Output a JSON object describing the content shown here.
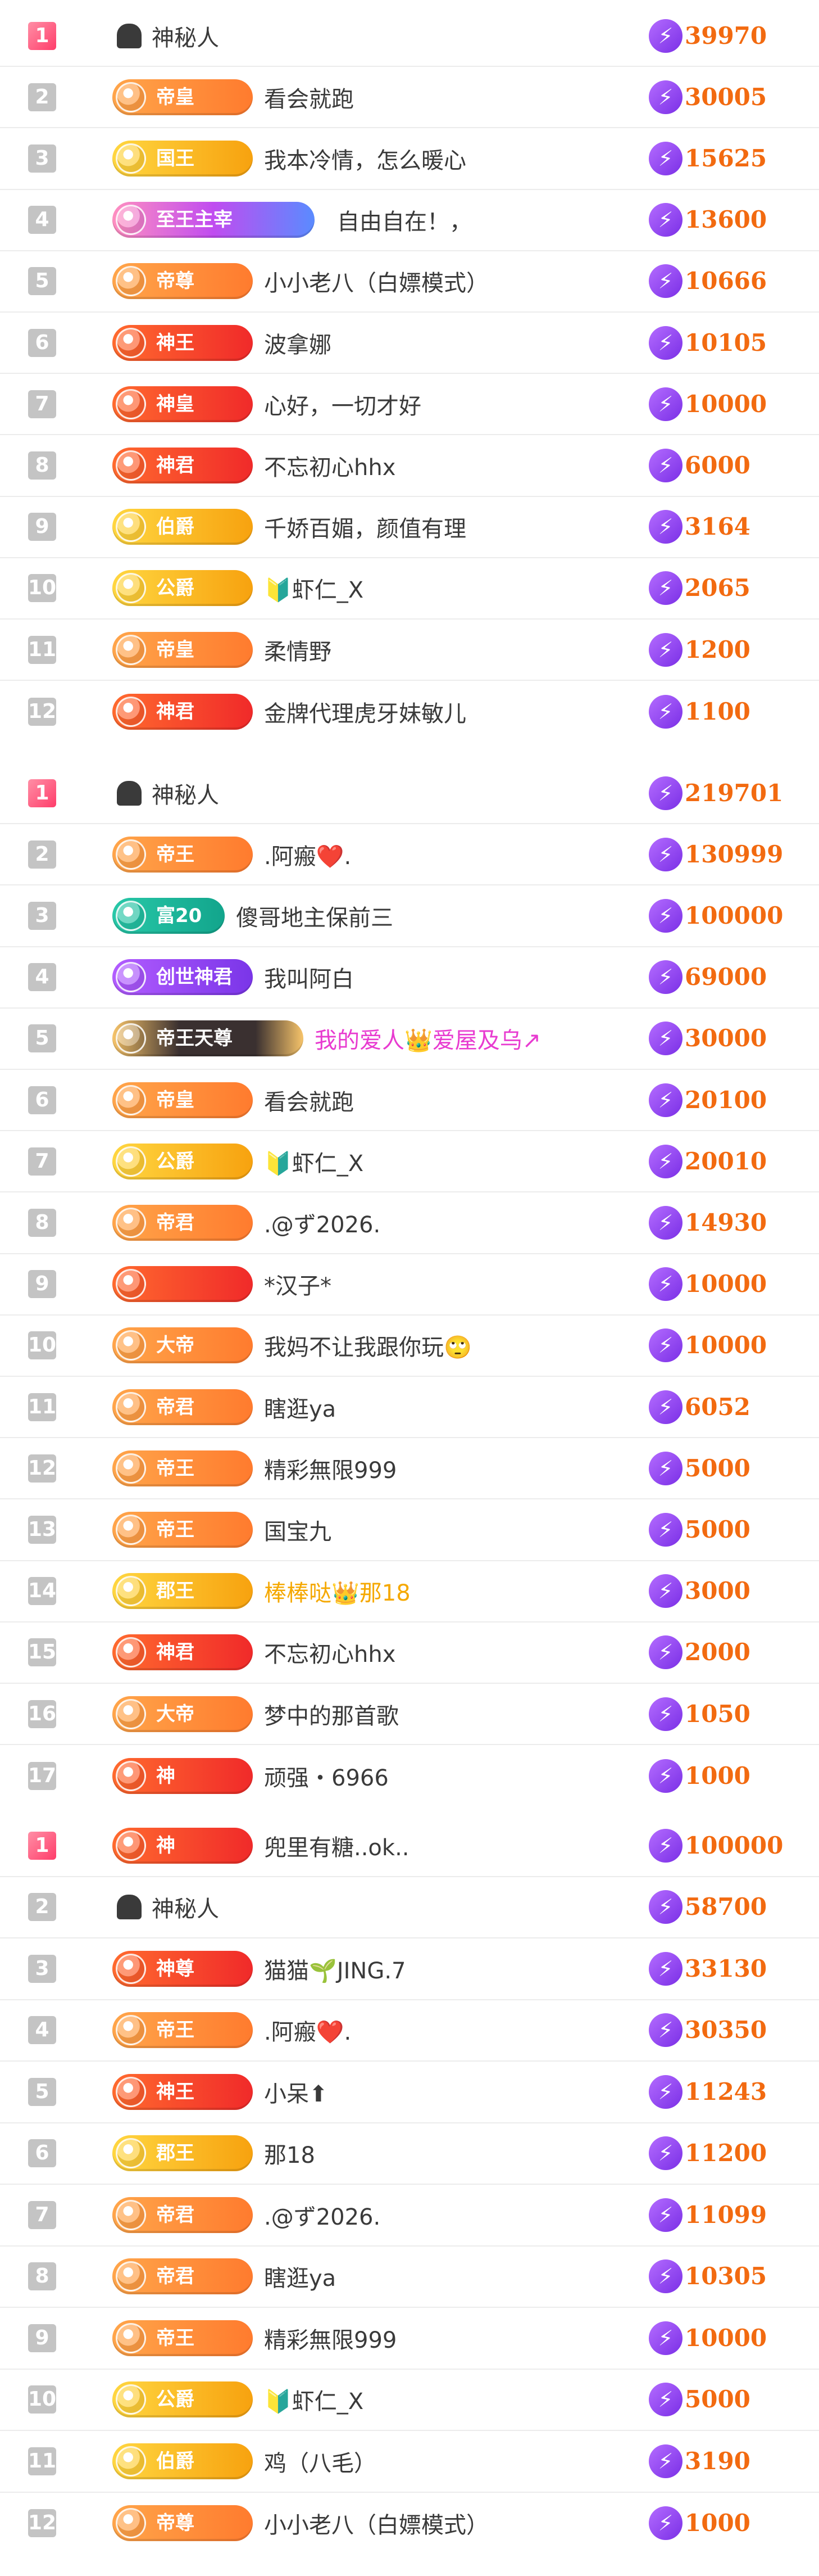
{
  "icons": {
    "bolt_icon": "lightning-bolt-icon",
    "badge_medal_icon": "medal-icon",
    "mystery_user_icon": "mystery-person-icon"
  },
  "colors": {
    "rank_first": "#ff3d6a",
    "rank_other": "#c4c4c4",
    "score_text": "#f26a10",
    "bolt_bg": "#7a2fe6"
  },
  "board1": {
    "rows": [
      {
        "rank": "1",
        "badge": "",
        "badge_style": "plain",
        "name": "神秘人",
        "score": "39970"
      },
      {
        "rank": "2",
        "badge": "帝皇",
        "badge_style": "orange",
        "name": "看会就跑",
        "score": "30005"
      },
      {
        "rank": "3",
        "badge": "国王",
        "badge_style": "gold",
        "name": "我本冷情，怎么暖心",
        "score": "15625"
      },
      {
        "rank": "4",
        "badge": "至王主宰",
        "badge_style": "pink",
        "name": "自由自在！，",
        "score": "13600"
      },
      {
        "rank": "5",
        "badge": "帝尊",
        "badge_style": "orange",
        "name": "小小老八（白嫖模式）",
        "score": "10666"
      },
      {
        "rank": "6",
        "badge": "神王",
        "badge_style": "red",
        "name": "波拿娜",
        "score": "10105"
      },
      {
        "rank": "7",
        "badge": "神皇",
        "badge_style": "red",
        "name": "心好，一切才好",
        "score": "10000"
      },
      {
        "rank": "8",
        "badge": "神君",
        "badge_style": "red",
        "name": "不忘初心hhx",
        "score": "6000"
      },
      {
        "rank": "9",
        "badge": "伯爵",
        "badge_style": "gold",
        "name": "千娇百媚，颜值有理",
        "score": "3164"
      },
      {
        "rank": "10",
        "badge": "公爵",
        "badge_style": "gold",
        "name": "🔰虾仁_X",
        "score": "2065"
      },
      {
        "rank": "11",
        "badge": "帝皇",
        "badge_style": "orange",
        "name": "柔情野",
        "score": "1200"
      },
      {
        "rank": "12",
        "badge": "神君",
        "badge_style": "red",
        "name": "金牌代理虎牙妹敏儿",
        "score": "1100"
      }
    ]
  },
  "board2": {
    "rows": [
      {
        "rank": "1",
        "badge": "",
        "badge_style": "plain",
        "name": "神秘人",
        "score": "219701"
      },
      {
        "rank": "2",
        "badge": "帝王",
        "badge_style": "orange",
        "name": ".阿瘢❤️.",
        "score": "130999"
      },
      {
        "rank": "3",
        "badge": "富20",
        "badge_style": "teal",
        "name": "傻哥地主保前三",
        "score": "100000"
      },
      {
        "rank": "4",
        "badge": "创世神君",
        "badge_style": "purple",
        "name": "我叫阿白",
        "score": "69000"
      },
      {
        "rank": "5",
        "badge": "帝王天尊",
        "badge_style": "dark",
        "name": "我的爱人👑爱屋及乌↗",
        "score": "30000"
      },
      {
        "rank": "6",
        "badge": "帝皇",
        "badge_style": "orange",
        "name": "看会就跑",
        "score": "20100"
      },
      {
        "rank": "7",
        "badge": "公爵",
        "badge_style": "gold",
        "name": "🔰虾仁_X",
        "score": "20010"
      },
      {
        "rank": "8",
        "badge": "帝君",
        "badge_style": "orange",
        "name": ".@ず2026.",
        "score": "14930"
      },
      {
        "rank": "9",
        "badge": "",
        "badge_style": "red",
        "name": "*汉子*",
        "score": "10000"
      },
      {
        "rank": "10",
        "badge": "大帝",
        "badge_style": "orange",
        "name": "我妈不让我跟你玩🙄",
        "score": "10000"
      },
      {
        "rank": "11",
        "badge": "帝君",
        "badge_style": "orange",
        "name": "瞎逛ya",
        "score": "6052"
      },
      {
        "rank": "12",
        "badge": "帝王",
        "badge_style": "orange",
        "name": "精彩無限999",
        "score": "5000"
      },
      {
        "rank": "13",
        "badge": "帝王",
        "badge_style": "orange",
        "name": "国宝九",
        "score": "5000"
      },
      {
        "rank": "14",
        "badge": "郡王",
        "badge_style": "gold",
        "name": "棒棒哒👑那18",
        "score": "3000"
      },
      {
        "rank": "15",
        "badge": "神君",
        "badge_style": "red",
        "name": "不忘初心hhx",
        "score": "2000"
      },
      {
        "rank": "16",
        "badge": "大帝",
        "badge_style": "orange",
        "name": "梦中的那首歌",
        "score": "1050"
      },
      {
        "rank": "17",
        "badge": "神",
        "badge_style": "red",
        "name": "顽强・6966",
        "score": "1000"
      }
    ]
  },
  "board3": {
    "rows": [
      {
        "rank": "1",
        "badge": "神",
        "badge_style": "red",
        "name": "兜里有糖..ok..",
        "score": "100000"
      },
      {
        "rank": "2",
        "badge": "",
        "badge_style": "plain",
        "name": "神秘人",
        "score": "58700"
      },
      {
        "rank": "3",
        "badge": "神尊",
        "badge_style": "red",
        "name": "猫猫🌱JING.7",
        "score": "33130"
      },
      {
        "rank": "4",
        "badge": "帝王",
        "badge_style": "orange",
        "name": ".阿瘢❤️.",
        "score": "30350"
      },
      {
        "rank": "5",
        "badge": "神王",
        "badge_style": "red",
        "name": "小呆⬆",
        "score": "11243"
      },
      {
        "rank": "6",
        "badge": "郡王",
        "badge_style": "gold",
        "name": "那18",
        "score": "11200"
      },
      {
        "rank": "7",
        "badge": "帝君",
        "badge_style": "orange",
        "name": ".@ず2026.",
        "score": "11099"
      },
      {
        "rank": "8",
        "badge": "帝君",
        "badge_style": "orange",
        "name": "瞎逛ya",
        "score": "10305"
      },
      {
        "rank": "9",
        "badge": "帝王",
        "badge_style": "orange",
        "name": "精彩無限999",
        "score": "10000"
      },
      {
        "rank": "10",
        "badge": "公爵",
        "badge_style": "gold",
        "name": "🔰虾仁_X",
        "score": "5000"
      },
      {
        "rank": "11",
        "badge": "伯爵",
        "badge_style": "gold",
        "name": "鸡（八毛）",
        "score": "3190"
      },
      {
        "rank": "12",
        "badge": "帝尊",
        "badge_style": "orange",
        "name": "小小老八（白嫖模式）",
        "score": "1000"
      }
    ]
  }
}
